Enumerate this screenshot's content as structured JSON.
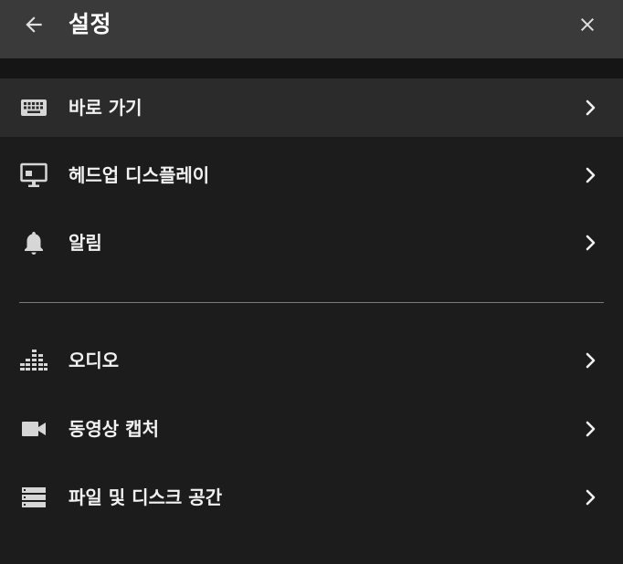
{
  "header": {
    "title": "설정",
    "back_icon": "back-arrow-icon",
    "close_icon": "close-icon"
  },
  "colors": {
    "background": "#1c1c1c",
    "header": "#3a3a3a",
    "selected_row": "#2b2b2b",
    "icon": "#d6d6d6",
    "text": "#f2f2f2"
  },
  "menu": {
    "group1": [
      {
        "label": "바로 가기",
        "icon": "keyboard-icon",
        "selected": true
      },
      {
        "label": "헤드업 디스플레이",
        "icon": "monitor-icon",
        "selected": false
      },
      {
        "label": "알림",
        "icon": "bell-icon",
        "selected": false
      }
    ],
    "group2": [
      {
        "label": "오디오",
        "icon": "audio-equalizer-icon",
        "selected": false
      },
      {
        "label": "동영상 캡처",
        "icon": "video-camera-icon",
        "selected": false
      },
      {
        "label": "파일 및 디스크 공간",
        "icon": "storage-icon",
        "selected": false
      }
    ]
  }
}
